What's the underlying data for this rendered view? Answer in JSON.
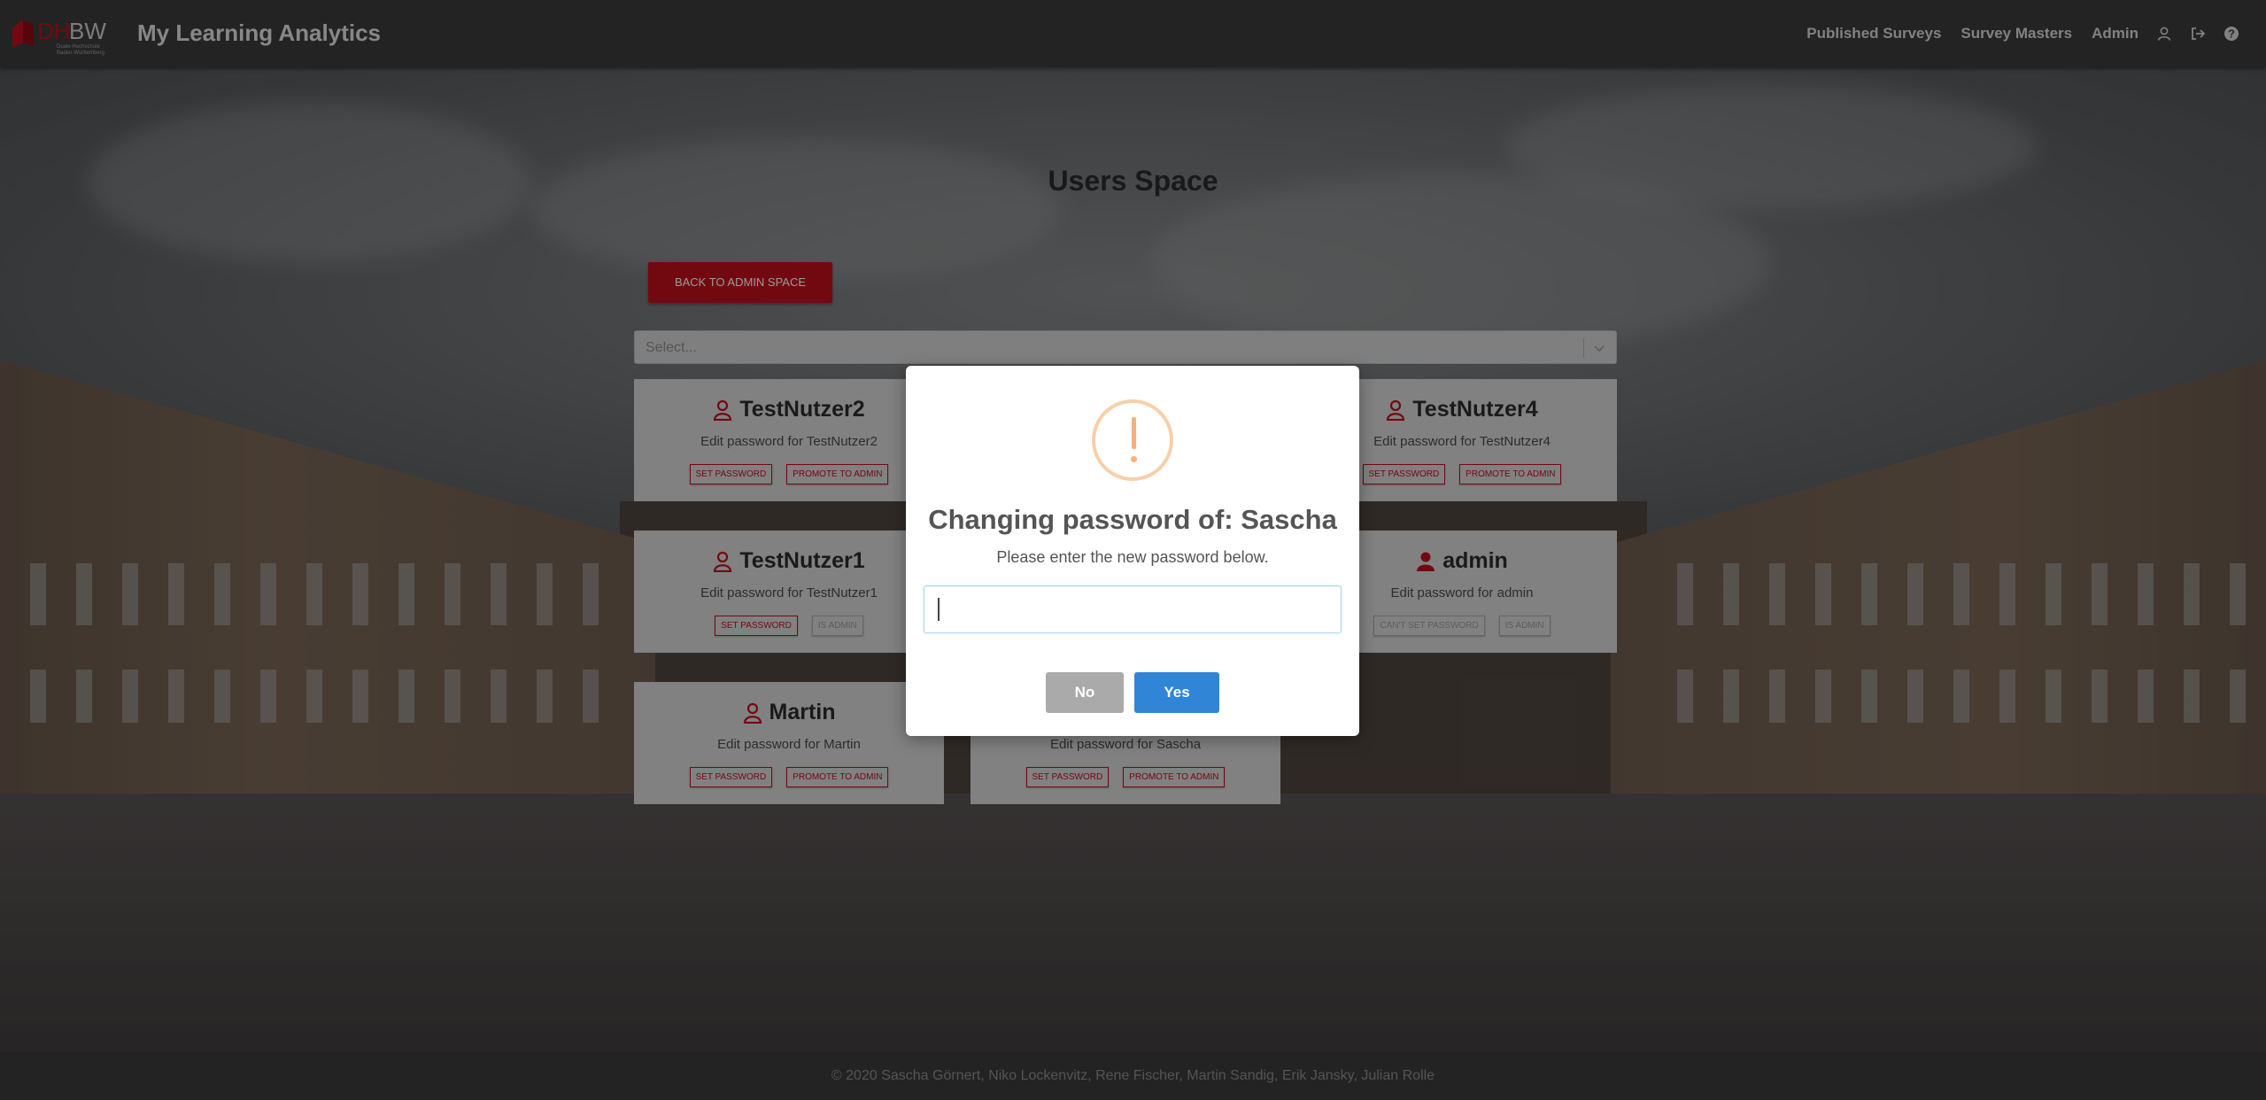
{
  "navbar": {
    "logo_text": "DHBW",
    "logo_sub": "Duale Hochschule Baden-Württemberg",
    "brand": "My Learning Analytics",
    "links": [
      "Published Surveys",
      "Survey Masters",
      "Admin"
    ],
    "icons": [
      "user-icon",
      "logout-icon",
      "help-icon"
    ]
  },
  "page": {
    "title": "Users Space",
    "back_button": "BACK TO ADMIN SPACE",
    "select_placeholder": "Select..."
  },
  "users": [
    {
      "name": "TestNutzer2",
      "desc": "Edit password for TestNutzer2",
      "btn1": "SET PASSWORD",
      "btn2": "PROMOTE TO ADMIN"
    },
    {
      "name": "TestNutzer4",
      "desc": "Edit password for TestNutzer4",
      "btn1": "SET PASSWORD",
      "btn2": "PROMOTE TO ADMIN"
    },
    {
      "name": "TestNutzer1",
      "desc": "Edit password for TestNutzer1",
      "btn1": "SET PASSWORD",
      "btn2": "IS ADMIN"
    },
    {
      "name": "admin",
      "desc": "Edit password for admin",
      "btn1": "CAN'T SET PASSWORD",
      "btn2": "IS ADMIN"
    },
    {
      "name": "Martin",
      "desc": "Edit password for Martin",
      "btn1": "SET PASSWORD",
      "btn2": "PROMOTE TO ADMIN"
    },
    {
      "name": "",
      "desc": "Edit password for Sascha",
      "btn1": "SET PASSWORD",
      "btn2": "PROMOTE TO ADMIN"
    }
  ],
  "modal": {
    "title": "Changing password of: Sascha",
    "text": "Please enter the new password below.",
    "input_value": "",
    "no_label": "No",
    "yes_label": "Yes"
  },
  "footer": {
    "text": "© 2020 Sascha Görnert, Niko Lockenvitz, Rene Fischer, Martin Sandig, Erik Jansky, Julian Rolle"
  },
  "colors": {
    "accent_red": "#c0101c",
    "confirm_blue": "#3085d6",
    "warning_orange": "#f6b07a"
  }
}
